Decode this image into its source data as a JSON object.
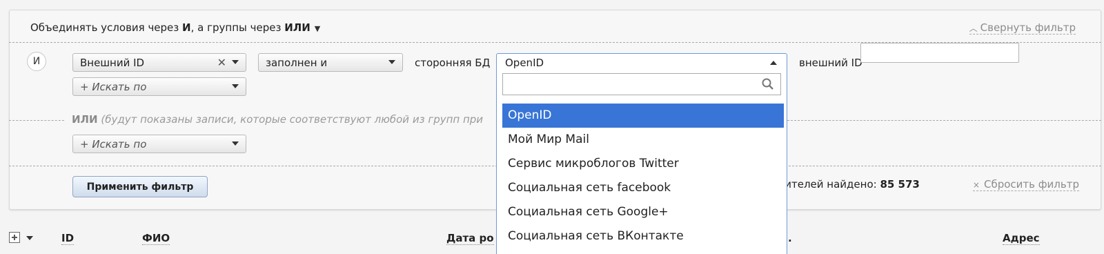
{
  "filter": {
    "combine_prefix": "Объединять условия через ",
    "combine_and": "И",
    "combine_middle": ", а группы через ",
    "combine_or": "ИЛИ",
    "collapse_label": "Свернуть фильтр",
    "and_badge": "И",
    "condition": {
      "field_select": "Внешний ID",
      "operator_select": "заполнен и",
      "third_party_label": "сторонняя БД",
      "db_select": "OpenID",
      "external_id_label": "внешний ID",
      "external_id_value": ""
    },
    "search_by_1": "+ Искать по",
    "or_label": "ИЛИ",
    "or_hint": "(будут показаны записи, которые соответствуют любой из групп при",
    "search_by_2": "+ Искать по",
    "apply_button": "Применить фильтр",
    "found_prefix": "бителей найдено: ",
    "found_count": "85 573",
    "reset_label": "Сбросить фильтр"
  },
  "dropdown": {
    "search_value": "",
    "options": [
      "OpenID",
      "Мой Мир Mail",
      "Сервис микроблогов Twitter",
      "Социальная сеть facebook",
      "Социальная сеть Google+",
      "Социальная сеть ВКонтакте"
    ],
    "selected_index": 0
  },
  "table": {
    "columns": [
      "ID",
      "ФИО",
      "Дата ро",
      "Адрес"
    ]
  },
  "colors": {
    "highlight": "#3875d7",
    "muted_text": "#8c8c8c"
  }
}
